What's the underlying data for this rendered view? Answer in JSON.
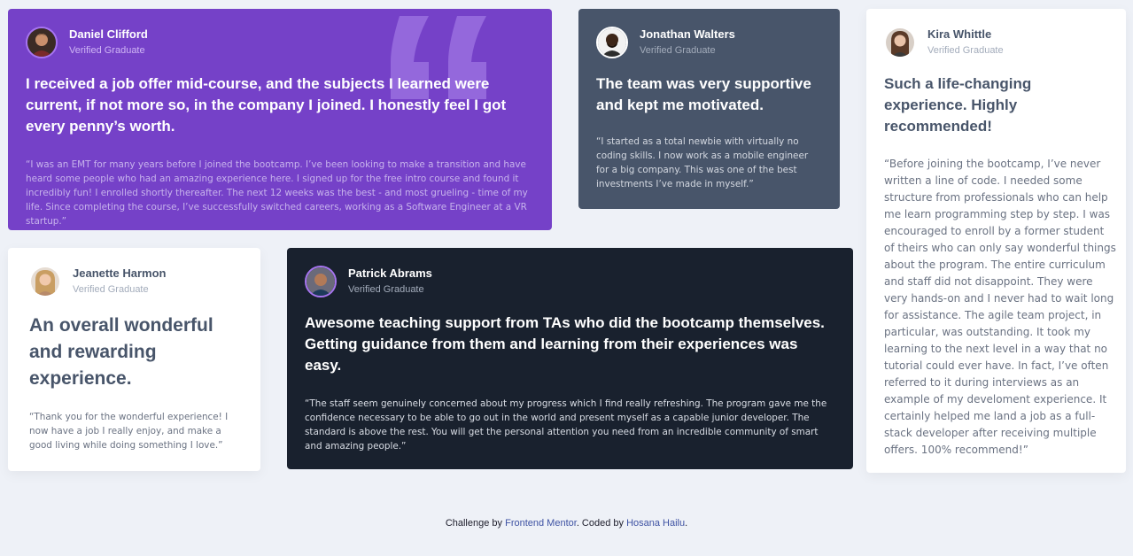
{
  "colors": {
    "page_bg": "#eef1f7",
    "purple": "#7541c8",
    "grayish_blue": "#48556a",
    "dark_blue": "#19212e",
    "white": "#ffffff",
    "link": "#3e52a3"
  },
  "testimonials": [
    {
      "name": "Daniel Clifford",
      "role": "Verified Graduate",
      "headline": "I received a job offer mid-course, and the subjects I learned were current, if not more so, in the company I joined. I honestly feel I got every penny’s worth.",
      "body": "“I was an EMT for many years before I joined the bootcamp. I’ve been looking to make a transition and have heard some people who had an amazing experience here. I signed up for the free intro course and found it incredibly fun! I enrolled shortly thereafter. The next 12 weeks was the best - and most grueling - time of my life. Since completing the course, I’ve successfully switched careers, working as a Software Engineer at a VR startup.”"
    },
    {
      "name": "Jonathan Walters",
      "role": "Verified Graduate",
      "headline": "The team was very supportive and kept me motivated.",
      "body": "“I started as a total newbie with virtually no coding skills. I now work as a mobile engineer for a big company. This was one of the best investments I’ve made in myself.”"
    },
    {
      "name": "Kira Whittle",
      "role": "Verified Graduate",
      "headline": "Such a life-changing experience. Highly recommended!",
      "body": "“Before joining the bootcamp, I’ve never written a line of code. I needed some structure from professionals who can help me learn programming step by step. I was encouraged to enroll by a former student of theirs who can only say wonderful things about the program. The entire curriculum and staff did not disappoint. They were very hands-on and I never had to wait long for assistance. The agile team project, in particular, was outstanding. It took my learning to the next level in a way that no tutorial could ever have. In fact, I’ve often referred to it during interviews as an example of my develoment experience. It certainly helped me land a job as a full-stack developer after receiving multiple offers. 100% recommend!”"
    },
    {
      "name": "Jeanette Harmon",
      "role": "Verified Graduate",
      "headline": "An overall wonderful and rewarding experience.",
      "body": "“Thank you for the wonderful experience! I now have a job I really enjoy, and make a good living while doing something I love.”"
    },
    {
      "name": "Patrick Abrams",
      "role": "Verified Graduate",
      "headline": "Awesome teaching support from TAs who did the bootcamp themselves. Getting guidance from them and learning from their experiences was easy.",
      "body": "“The staff seem genuinely concerned about my progress which I find really refreshing. The program gave me the confidence necessary to be able to go out in the world and present myself as a capable junior developer. The standard is above the rest. You will get the personal attention you need from an incredible community of smart and amazing people.”"
    }
  ],
  "footer": {
    "prefix": "Challenge by",
    "link1": "Frontend Mentor",
    "middle": ". Coded by",
    "link2": "Hosana Hailu",
    "suffix": "."
  }
}
